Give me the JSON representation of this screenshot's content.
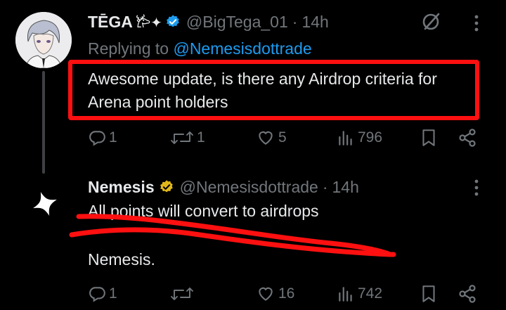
{
  "tweets": [
    {
      "display_name": "TĒGA",
      "name_decoration": "𐂂✦",
      "handle": "@BigTega_01",
      "separator": "·",
      "time": "14h",
      "replying_prefix": "Replying to",
      "replying_to": "@Nemesisdottrade",
      "text": "Awesome update, is there any Airdrop criteria for Arena point holders",
      "verified_color": "#1d9bf0",
      "actions": {
        "replies": "1",
        "retweets": "1",
        "likes": "5",
        "views": "796"
      }
    },
    {
      "display_name": "Nemesis",
      "handle": "@Nemesisdottrade",
      "separator": "·",
      "time": "14h",
      "text_line1": "All points will convert to airdrops",
      "text_line2": "Nemesis.",
      "verified_color": "#e2b719",
      "actions": {
        "replies": "1",
        "retweets": "",
        "likes": "16",
        "views": "742"
      }
    }
  ],
  "colors": {
    "annotation_red": "#ff1010",
    "muted": "#71767b",
    "link": "#1d9bf0"
  }
}
